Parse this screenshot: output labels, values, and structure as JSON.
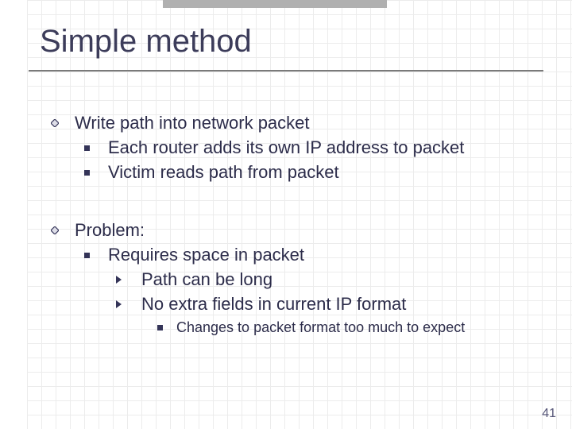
{
  "title": "Simple method",
  "page_number": "41",
  "block1": {
    "l1": "Write path into network packet",
    "l2a": "Each router adds its own IP address to packet",
    "l2b": "Victim reads path from packet"
  },
  "block2": {
    "l1": "Problem:",
    "l2": "Requires space in packet",
    "l3a": "Path can be long",
    "l3b": "No extra fields in current IP format",
    "l4": "Changes to packet format too much to expect"
  }
}
